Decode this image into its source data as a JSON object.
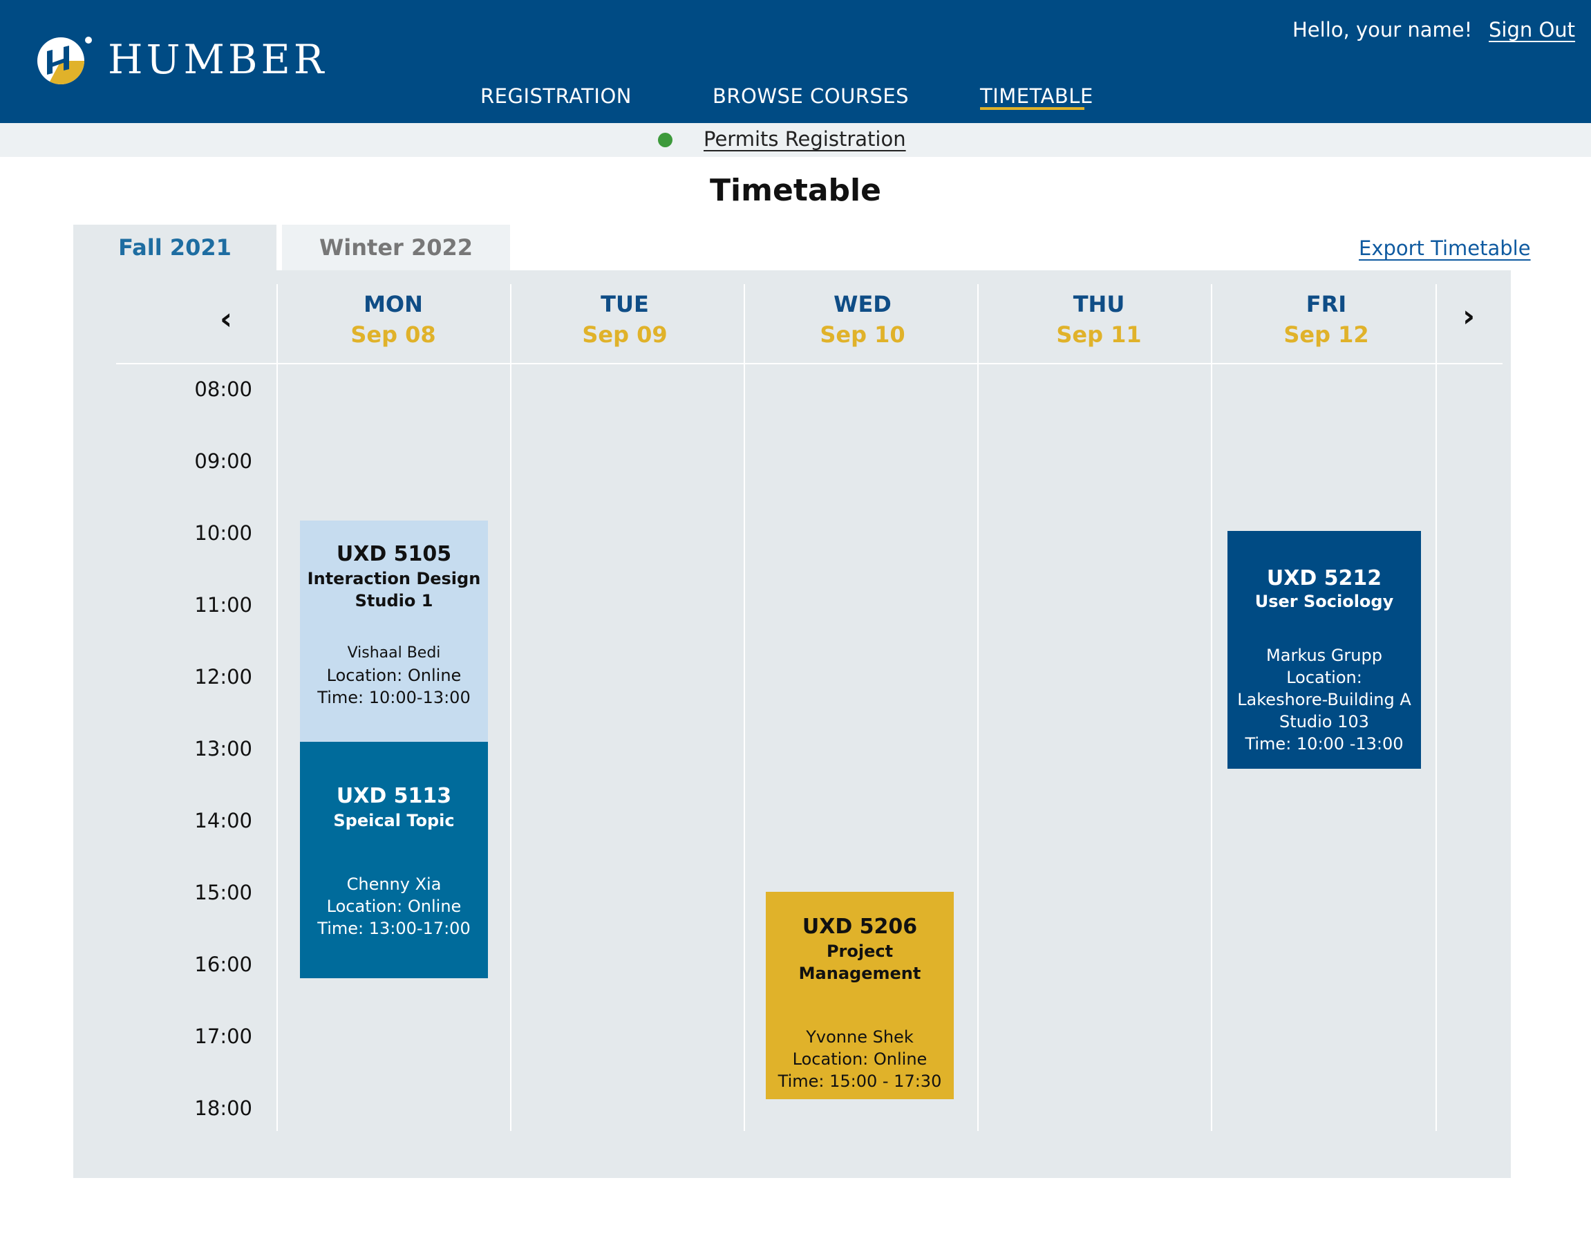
{
  "brand": {
    "name": "HUMBER"
  },
  "user": {
    "greeting": "Hello, your name!",
    "sign_out": "Sign Out"
  },
  "nav": {
    "registration": "REGISTRATION",
    "browse_courses": "BROWSE COURSES",
    "timetable": "TIMETABLE",
    "active": "TIMETABLE"
  },
  "permits": {
    "label": "Permits Registration",
    "status_color": "#3d9a3b"
  },
  "page": {
    "title": "Timetable"
  },
  "terms": {
    "fall": "Fall 2021",
    "winter": "Winter 2022",
    "selected": "Fall 2021"
  },
  "export_label": "Export Timetable",
  "calendar": {
    "days": [
      {
        "name": "MON",
        "date": "Sep 08"
      },
      {
        "name": "TUE",
        "date": "Sep 09"
      },
      {
        "name": "WED",
        "date": "Sep 10"
      },
      {
        "name": "THU",
        "date": "Sep 11"
      },
      {
        "name": "FRI",
        "date": "Sep 12"
      }
    ],
    "times": [
      "08:00",
      "09:00",
      "10:00",
      "11:00",
      "12:00",
      "13:00",
      "14:00",
      "15:00",
      "16:00",
      "17:00",
      "18:00"
    ],
    "prev_icon": "chevron-left-icon",
    "next_icon": "chevron-right-icon",
    "events": [
      {
        "code": "UXD 5105",
        "name_line1": "Interaction Design",
        "name_line2": "Studio 1",
        "instructor": "Vishaal Bedi",
        "location": "Location: Online",
        "time": "Time: 10:00-13:00",
        "color": "#c6dcef"
      },
      {
        "code": "UXD 5113",
        "name": "Speical Topic",
        "instructor": "Chenny Xia",
        "location": "Location: Online",
        "time": "Time: 13:00-17:00",
        "color": "#006b9b"
      },
      {
        "code": "UXD 5206",
        "name": "Project Management",
        "instructor": "Yvonne Shek",
        "location": "Location: Online",
        "time": "Time: 15:00 - 17:30",
        "color": "#e0b22a"
      },
      {
        "code": "UXD 5212",
        "name": "User Sociology",
        "instructor": "Markus Grupp",
        "location_line1": "Location:",
        "location_line2": "Lakeshore-Building A",
        "location_line3": "Studio 103",
        "time": "Time: 10:00 -13:00",
        "color": "#004b84"
      }
    ]
  },
  "colors": {
    "header_bg": "#004b84",
    "accent": "#e0b22a",
    "panel_bg": "#e4e9ec",
    "day_name": "#0f4d86"
  }
}
